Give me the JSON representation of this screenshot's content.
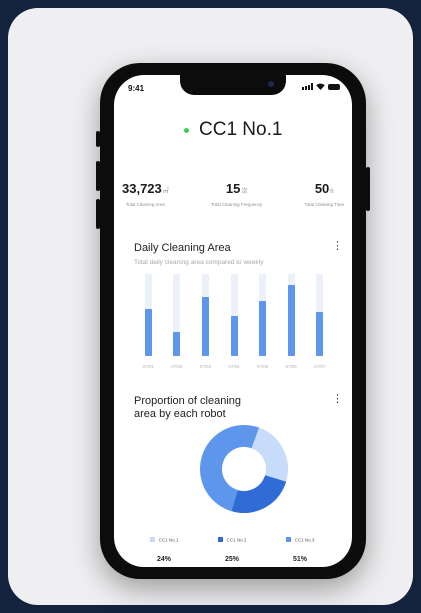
{
  "status_bar": {
    "time": "9:41"
  },
  "device": {
    "name": "CC1 No.1",
    "status_color": "#3dcc5a"
  },
  "stats": [
    {
      "value": "33,723",
      "unit": "㎡",
      "label": "Total Cleaning Area"
    },
    {
      "value": "15",
      "unit": "次",
      "label": "Total Cleaning Frequency"
    },
    {
      "value": "50",
      "unit": "h",
      "label": "Total Cleaning Time"
    }
  ],
  "daily_area": {
    "title": "Daily Cleaning Area",
    "subtitle": "Total daily cleaning area compared to weekly",
    "more_label": "⋮"
  },
  "proportion": {
    "title_line1": "Proportion of cleaning",
    "title_line2": "area by each robot",
    "more_label": "⋮"
  },
  "chart_data": [
    {
      "type": "bar",
      "categories": [
        "07/01",
        "07/02",
        "07/03",
        "07/04",
        "07/05",
        "07/06",
        "07/07"
      ],
      "values": [
        0.57,
        0.29,
        0.72,
        0.49,
        0.67,
        0.87,
        0.54
      ],
      "ylim": [
        0,
        1
      ],
      "color": "#5e96ec",
      "track_color": "#ecf0f8"
    },
    {
      "type": "pie",
      "labels": [
        "CC1 No.1",
        "CC1 No.2",
        "CC1 No.3"
      ],
      "values": [
        24,
        25,
        51
      ],
      "value_labels": [
        "24%",
        "25%",
        "51%"
      ],
      "colors": [
        "#c6dcfa",
        "#2f6cd6",
        "#5e96ec"
      ]
    }
  ]
}
